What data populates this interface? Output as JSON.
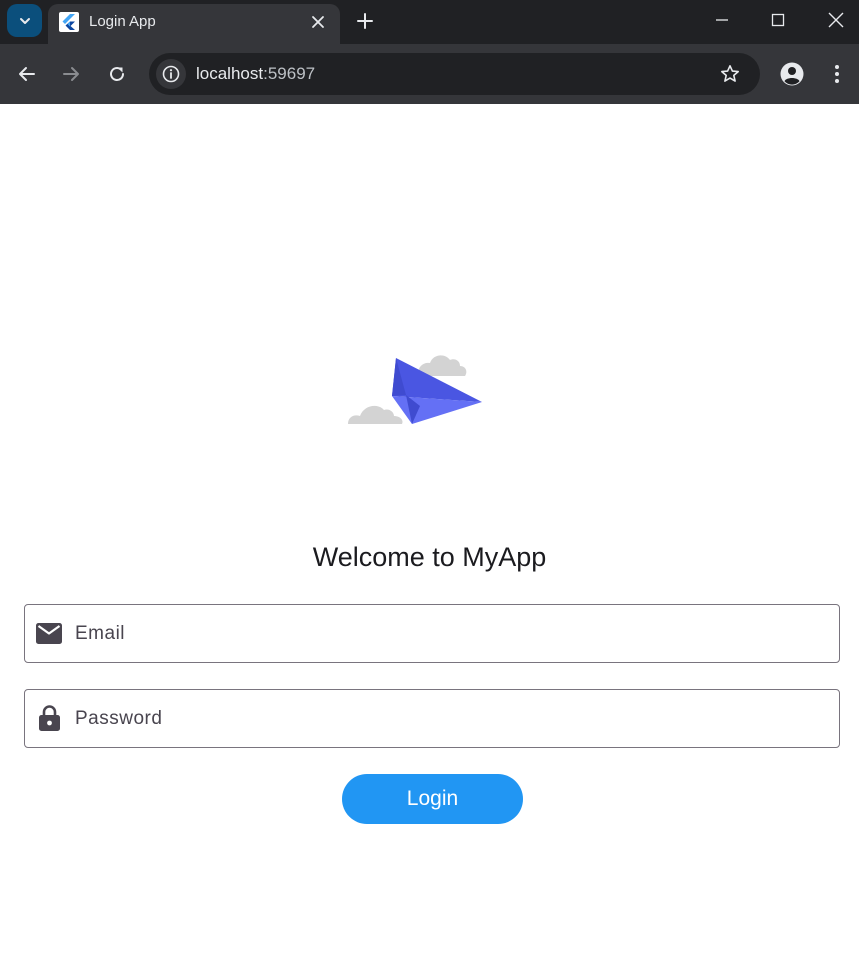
{
  "browser": {
    "tab": {
      "title": "Login App",
      "favicon": "flutter-icon"
    },
    "address": {
      "host": "localhost",
      "port": ":59697"
    },
    "icons": {
      "tab_search": "chevron-down-icon",
      "tab_close": "close-icon",
      "new_tab": "plus-icon",
      "minimize": "minimize-icon",
      "maximize": "maximize-icon",
      "close_window": "close-icon",
      "back": "arrow-left-icon",
      "forward": "arrow-right-icon",
      "reload": "reload-icon",
      "site_info": "info-icon",
      "bookmark": "star-icon",
      "profile": "profile-icon",
      "menu": "more-vert-icon"
    },
    "colors": {
      "frame": "#202124",
      "toolbar": "#35363a",
      "accent": "#0b4f7c"
    }
  },
  "app": {
    "logo_icon": "paper-plane-icon",
    "welcome_text": "Welcome to MyApp",
    "email": {
      "placeholder": "Email",
      "value": "",
      "icon": "mail-icon"
    },
    "password": {
      "placeholder": "Password",
      "value": "",
      "icon": "lock-icon"
    },
    "login_label": "Login",
    "colors": {
      "primary": "#2196f3",
      "plane": "#5865f2",
      "cloud": "#d3d3d3"
    }
  }
}
